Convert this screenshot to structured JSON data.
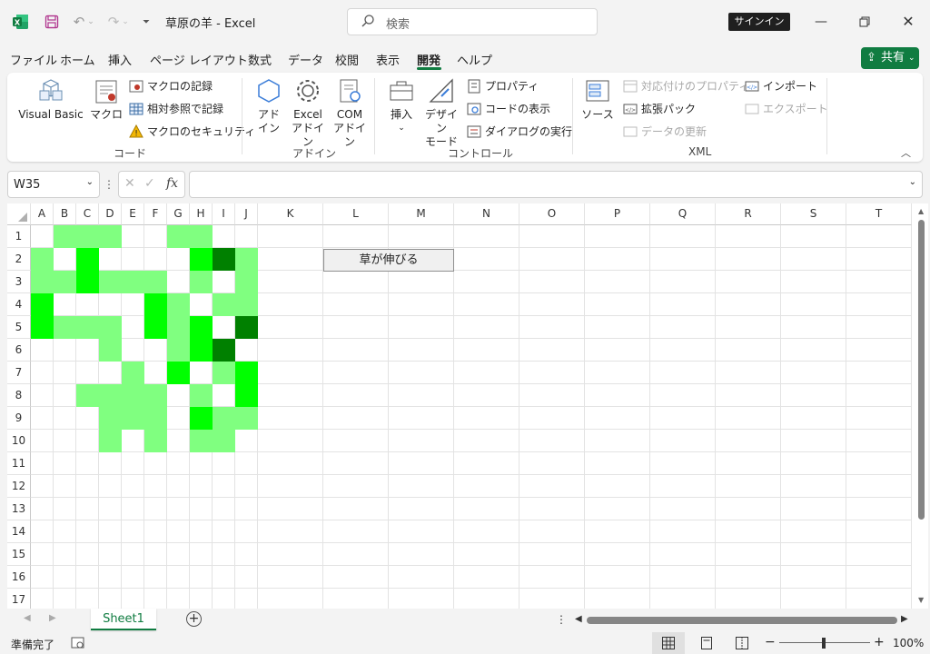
{
  "titlebar": {
    "title": "草原の羊  -  Excel",
    "search_placeholder": "検索",
    "signin_label": "サインイン"
  },
  "menu": {
    "tabs": [
      "ファイル",
      "ホーム",
      "挿入",
      "ページ レイアウト",
      "数式",
      "データ",
      "校閲",
      "表示",
      "開発",
      "ヘルプ"
    ],
    "active": "開発",
    "share_label": "共有"
  },
  "ribbon": {
    "code": {
      "label": "コード",
      "visual_basic": "Visual Basic",
      "macro": "マクロ",
      "record_macro": "マクロの記録",
      "relative_ref": "相対参照で記録",
      "macro_security": "マクロのセキュリティ"
    },
    "addins": {
      "label": "アドイン",
      "addin_l1": "アド",
      "addin_l2": "イン",
      "excel_addin_l1": "Excel",
      "excel_addin_l2": "アドイン",
      "com_addin_l1": "COM",
      "com_addin_l2": "アドイン"
    },
    "controls": {
      "label": "コントロール",
      "insert": "挿入",
      "design_l1": "デザイン",
      "design_l2": "モード",
      "properties": "プロパティ",
      "view_code": "コードの表示",
      "run_dialog": "ダイアログの実行"
    },
    "xml": {
      "label": "XML",
      "source": "ソース",
      "map_props": "対応付けのプロパティ",
      "expansion_packs": "拡張パック",
      "refresh_data": "データの更新",
      "import": "インポート",
      "export": "エクスポート"
    }
  },
  "formula_bar": {
    "name_box": "W35",
    "fx": "fx",
    "formula": ""
  },
  "sheet": {
    "columns": [
      "A",
      "B",
      "C",
      "D",
      "E",
      "F",
      "G",
      "H",
      "I",
      "J",
      "K",
      "L",
      "M",
      "N",
      "O",
      "P",
      "Q",
      "R",
      "S",
      "T"
    ],
    "rows": [
      "1",
      "2",
      "3",
      "4",
      "5",
      "6",
      "7",
      "8",
      "9",
      "10",
      "11",
      "12",
      "13",
      "14",
      "15",
      "16",
      "17"
    ],
    "button_label": "草が伸びる",
    "colors": {
      "L": "#80ff80",
      "B": "#00ff00",
      "D": "#008000"
    },
    "cell_fills": [
      ".LLL..LL..",
      "L.B....BDL",
      "LLBLLL.L.L",
      "B....BL.LL",
      "BLLL.BLB.D",
      "...L..LBD.",
      "....L.B.LB",
      "..LLLL.L.B",
      "...LLL.BLL",
      "...L.L.LL."
    ]
  },
  "sheet_tabs": {
    "active": "Sheet1"
  },
  "status": {
    "ready": "準備完了",
    "zoom": "100%"
  }
}
